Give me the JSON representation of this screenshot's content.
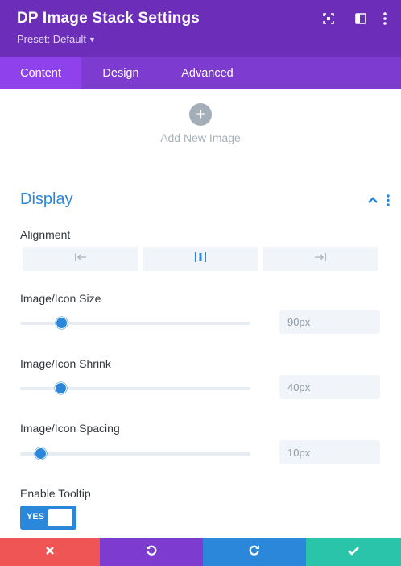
{
  "header": {
    "title": "DP Image Stack Settings",
    "preset": "Preset: Default",
    "icons": [
      "expand-icon",
      "sidebar-icon",
      "more-vertical-icon"
    ]
  },
  "tabs": [
    {
      "label": "Content",
      "active": true
    },
    {
      "label": "Design",
      "active": false
    },
    {
      "label": "Advanced",
      "active": false
    }
  ],
  "add_image": {
    "label": "Add New Image",
    "icon": "plus-icon"
  },
  "display": {
    "title": "Display",
    "alignment": {
      "label": "Alignment",
      "options": [
        "align-left-icon",
        "align-center-icon",
        "align-right-icon"
      ]
    },
    "size": {
      "label": "Image/Icon Size",
      "value": "90px",
      "slider_fraction": 0.18
    },
    "shrink": {
      "label": "Image/Icon Shrink",
      "value": "40px",
      "slider_fraction": 0.175
    },
    "spacing": {
      "label": "Image/Icon Spacing",
      "value": "10px",
      "slider_fraction": 0.09
    },
    "tooltip": {
      "label": "Enable Tooltip",
      "toggle": "YES"
    }
  },
  "footer": {
    "buttons": [
      "close-icon",
      "undo-icon",
      "redo-icon",
      "check-icon"
    ]
  },
  "colors": {
    "header": "#6c2eb9",
    "tabs": "#7e3bd0",
    "tab_active": "#8f42ec",
    "accent_blue": "#2b87da",
    "cancel": "#ef5555",
    "save": "#29c4a9"
  }
}
